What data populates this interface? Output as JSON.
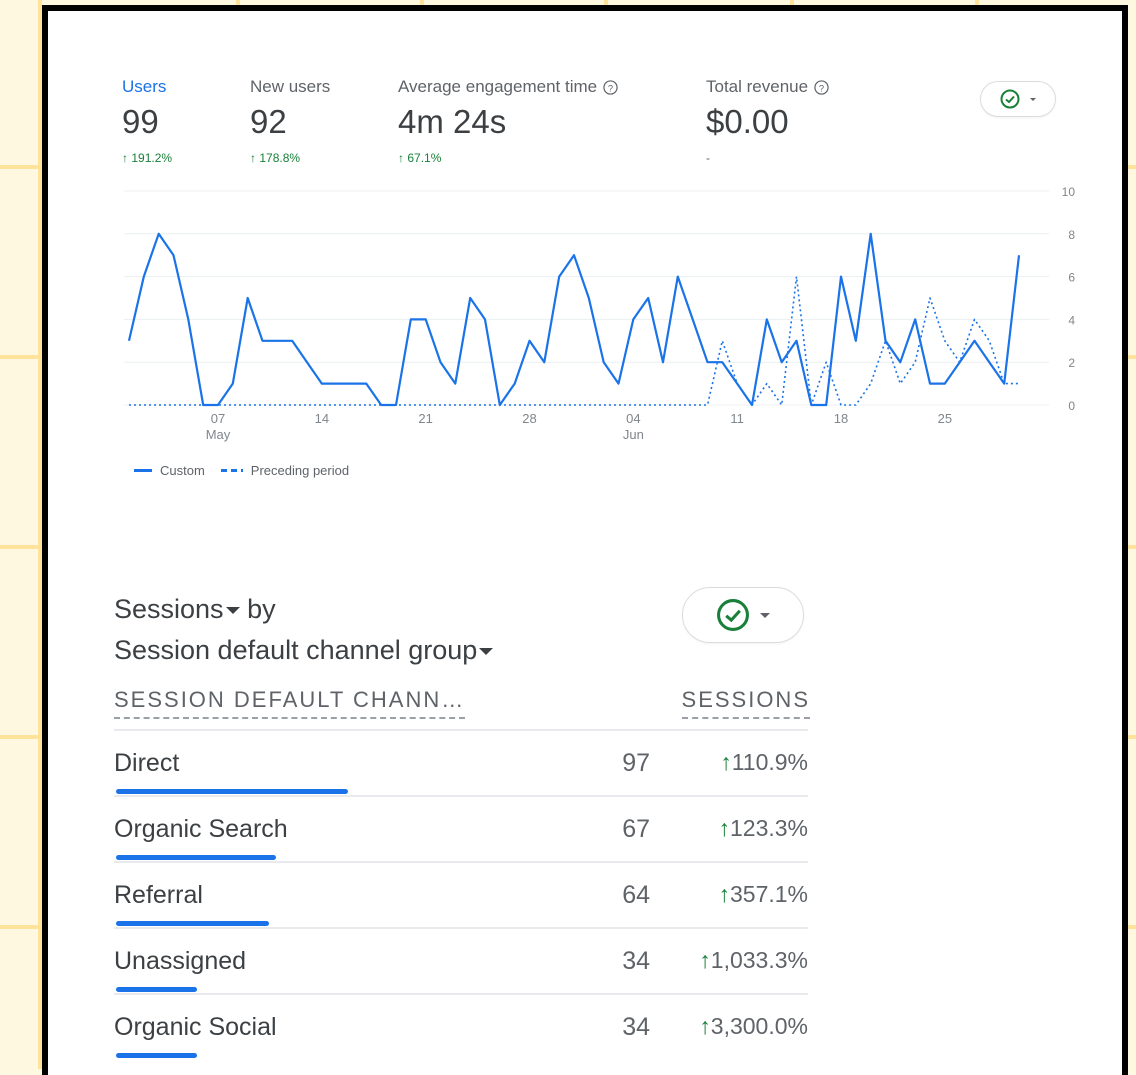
{
  "metrics": [
    {
      "label": "Users",
      "value": "99",
      "change": "191.2%"
    },
    {
      "label": "New users",
      "value": "92",
      "change": "178.8%"
    },
    {
      "label": "Average engagement time",
      "value": "4m 24s",
      "change": "67.1%"
    },
    {
      "label": "Total revenue",
      "value": "$0.00",
      "change": "-"
    }
  ],
  "colors": {
    "accent": "#1a73e8",
    "positive": "#188038",
    "background_grid": "#ffe39a"
  },
  "icons": {
    "status": "check-circle-icon",
    "help": "help-circle-icon",
    "dropdown": "caret-down-icon"
  },
  "chart_data": {
    "type": "line",
    "x_tick_labels": [
      {
        "day": "07",
        "month": "May"
      },
      {
        "day": "14",
        "month": ""
      },
      {
        "day": "21",
        "month": ""
      },
      {
        "day": "28",
        "month": ""
      },
      {
        "day": "04",
        "month": "Jun"
      },
      {
        "day": "11",
        "month": ""
      },
      {
        "day": "18",
        "month": ""
      },
      {
        "day": "25",
        "month": ""
      }
    ],
    "y_ticks": [
      "10",
      "8",
      "6",
      "4",
      "2",
      "0"
    ],
    "ylim": [
      0,
      10
    ],
    "legend": [
      "Custom",
      "Preceding period"
    ],
    "series": [
      {
        "name": "Custom",
        "style": "solid",
        "values": [
          3,
          6,
          8,
          7,
          4,
          0,
          0,
          1,
          5,
          3,
          3,
          3,
          2,
          1,
          1,
          1,
          1,
          0,
          0,
          4,
          4,
          2,
          1,
          5,
          4,
          0,
          1,
          3,
          2,
          6,
          7,
          5,
          2,
          1,
          4,
          5,
          2,
          6,
          4,
          2,
          2,
          1,
          0,
          4,
          2,
          3,
          0,
          0,
          6,
          3,
          8,
          3,
          2,
          4,
          1,
          1,
          2,
          3,
          2,
          1,
          7
        ]
      },
      {
        "name": "Preceding period",
        "style": "dashed",
        "values": [
          0,
          0,
          0,
          0,
          0,
          0,
          0,
          0,
          0,
          0,
          0,
          0,
          0,
          0,
          0,
          0,
          0,
          0,
          0,
          0,
          0,
          0,
          0,
          0,
          0,
          0,
          0,
          0,
          0,
          0,
          0,
          0,
          0,
          0,
          0,
          0,
          0,
          0,
          0,
          0,
          3,
          1,
          0,
          1,
          0,
          6,
          0,
          2,
          0,
          0,
          1,
          3,
          1,
          2,
          5,
          3,
          2,
          4,
          3,
          1,
          1
        ]
      }
    ]
  },
  "sessions": {
    "title_metric": "Sessions",
    "title_by": "by",
    "title_dimension": "Session default channel group",
    "col_dimension": "SESSION DEFAULT CHANN…",
    "col_metric": "SESSIONS",
    "rows": [
      {
        "name": "Direct",
        "value": "97",
        "change": "110.9%",
        "share": 1.0
      },
      {
        "name": "Organic Search",
        "value": "67",
        "change": "123.3%",
        "share": 0.69
      },
      {
        "name": "Referral",
        "value": "64",
        "change": "357.1%",
        "share": 0.66
      },
      {
        "name": "Unassigned",
        "value": "34",
        "change": "1,033.3%",
        "share": 0.35
      },
      {
        "name": "Organic Social",
        "value": "34",
        "change": "3,300.0%",
        "share": 0.35
      }
    ]
  }
}
